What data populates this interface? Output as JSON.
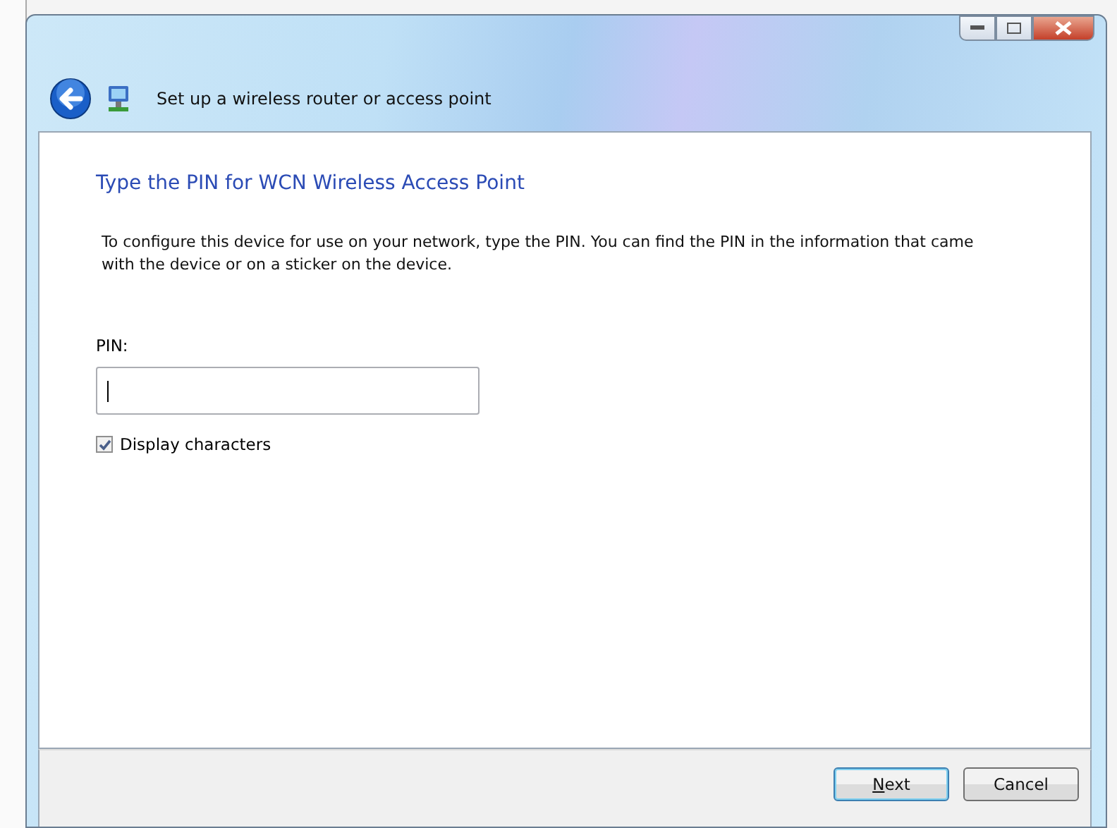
{
  "window": {
    "title": "Set up a wireless router or access point"
  },
  "page": {
    "heading": "Type the PIN for WCN Wireless Access Point",
    "description": "To configure this device for use on your network, type the PIN. You can find the PIN in the information that came with the device or on a sticker on the device."
  },
  "pin_field": {
    "label": "PIN:",
    "focused": true
  },
  "display_characters": {
    "label": "Display characters",
    "checked": true
  },
  "buttons": [
    {
      "label": "Next",
      "mnemonic": true,
      "default": true
    },
    {
      "label": "Cancel",
      "mnemonic": false,
      "default": false
    }
  ]
}
